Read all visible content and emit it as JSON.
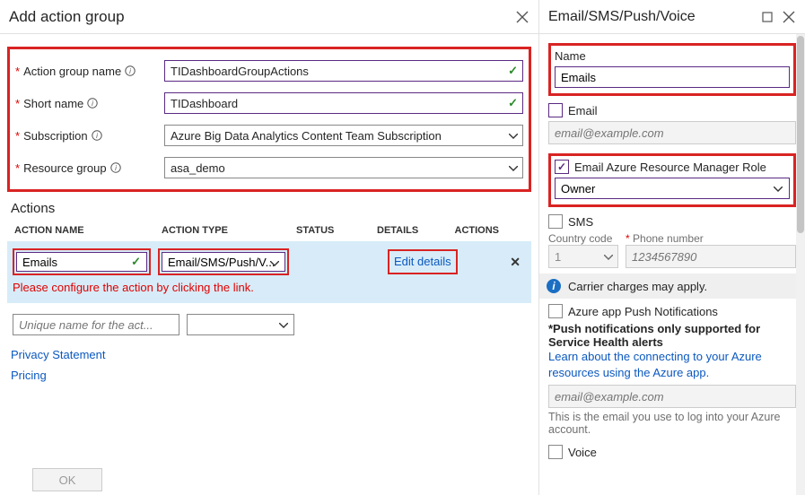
{
  "left": {
    "title": "Add action group",
    "fields": {
      "group_name_label": "Action group name",
      "group_name_value": "TIDashboardGroupActions",
      "short_name_label": "Short name",
      "short_name_value": "TIDashboard",
      "subscription_label": "Subscription",
      "subscription_value": "Azure Big Data Analytics Content Team Subscription",
      "resource_group_label": "Resource group",
      "resource_group_value": "asa_demo"
    },
    "actions_header": "Actions",
    "columns": {
      "name": "ACTION NAME",
      "type": "ACTION TYPE",
      "status": "STATUS",
      "details": "DETAILS",
      "actions": "ACTIONS"
    },
    "row": {
      "name": "Emails",
      "type": "Email/SMS/Push/V...",
      "edit": "Edit details"
    },
    "warn": "Please configure the action by clicking the link.",
    "new_row_placeholder": "Unique name for the act...",
    "privacy": "Privacy Statement",
    "pricing": "Pricing",
    "ok": "OK"
  },
  "right": {
    "title": "Email/SMS/Push/Voice",
    "name_label": "Name",
    "name_value": "Emails",
    "email_label": "Email",
    "email_placeholder": "email@example.com",
    "arm_label": "Email Azure Resource Manager Role",
    "arm_value": "Owner",
    "sms_label": "SMS",
    "country_label": "Country code",
    "country_value": "1",
    "phone_label": "Phone number",
    "phone_placeholder": "1234567890",
    "carrier_msg": "Carrier charges may apply.",
    "push_label": "Azure app Push Notifications",
    "push_note": "*Push notifications only supported for Service Health alerts",
    "push_learn": "Learn about the connecting to your Azure resources using the Azure app.",
    "push_placeholder": "email@example.com",
    "push_hint": "This is the email you use to log into your Azure account.",
    "voice_label": "Voice",
    "required_star": "*"
  }
}
